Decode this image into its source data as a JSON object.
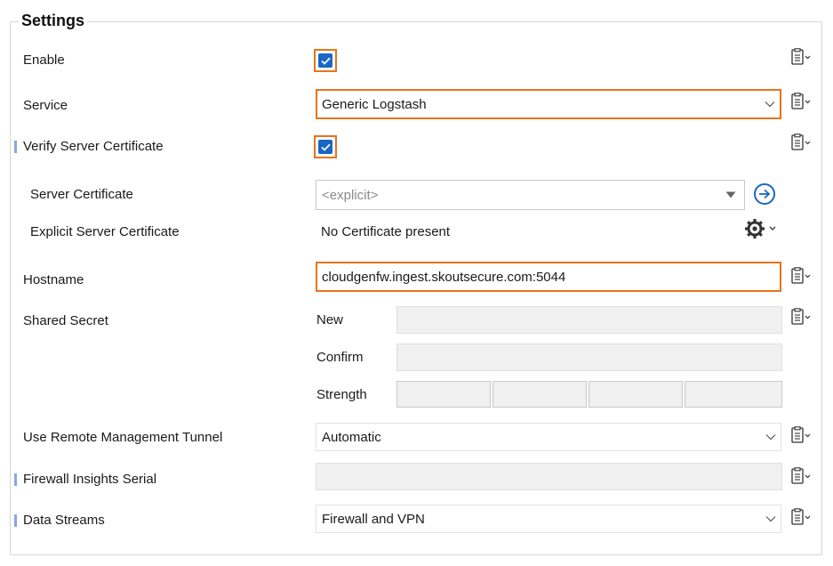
{
  "settings": {
    "title": "Settings",
    "enable": {
      "label": "Enable",
      "checked": true
    },
    "service": {
      "label": "Service",
      "value": "Generic Logstash"
    },
    "verify_server_certificate": {
      "label": "Verify Server Certificate",
      "checked": true
    },
    "server_certificate": {
      "label": "Server Certificate",
      "placeholder": "<explicit>"
    },
    "explicit_server_certificate": {
      "label": "Explicit Server Certificate",
      "value": "No Certificate present"
    },
    "hostname": {
      "label": "Hostname",
      "value": "cloudgenfw.ingest.skoutsecure.com:5044"
    },
    "shared_secret": {
      "label": "Shared Secret",
      "new_label": "New",
      "confirm_label": "Confirm",
      "strength_label": "Strength",
      "new_value": "",
      "confirm_value": ""
    },
    "use_remote_management_tunnel": {
      "label": "Use Remote Management Tunnel",
      "value": "Automatic"
    },
    "firewall_insights_serial": {
      "label": "Firewall Insights Serial",
      "value": ""
    },
    "data_streams": {
      "label": "Data Streams",
      "value": "Firewall and VPN"
    }
  },
  "colors": {
    "highlight_border": "#e8731a",
    "checkbox_fill": "#1a66c4",
    "marker": "#8aa6e0"
  },
  "icons": [
    "clipboard-menu-icon",
    "gear-icon",
    "chevron-down-icon",
    "circle-arrow-right-icon",
    "checkmark-icon",
    "triangle-down-icon"
  ]
}
